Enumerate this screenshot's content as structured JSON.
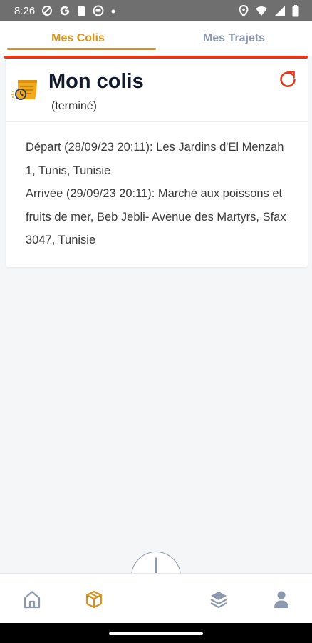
{
  "status_bar": {
    "time": "8:26",
    "left_icons": [
      "shield-icon",
      "google-icon",
      "sim-icon",
      "robot-icon",
      "dot-icon"
    ],
    "right_icons": [
      "location-icon",
      "wifi-icon",
      "signal-icon",
      "battery-icon"
    ]
  },
  "tabs": [
    {
      "label": "Mes Colis",
      "active": true
    },
    {
      "label": "Mes Trajets",
      "active": false
    }
  ],
  "colors": {
    "accent": "#d6921a",
    "inactive": "#8c98b0",
    "alert": "#e8351a",
    "title": "#141a2e"
  },
  "card": {
    "icon": "parcel-clock-icon",
    "title": "Mon colis",
    "status": "(terminé)",
    "refresh_icon": "refresh-icon",
    "departure": "Départ (28/09/23 20:11):  Les Jardins d'El Menzah 1, Tunis, Tunisie",
    "arrival": "Arrivée (29/09/23 20:11):  Marché aux poissons et fruits de mer, Beb Jebli- Avenue des Martyrs, Sfax 3047, Tunisie"
  },
  "bottom_nav": {
    "items": [
      "home-icon",
      "package-icon",
      "layers-icon",
      "profile-icon"
    ],
    "active": "package-icon",
    "fab_icon": "plus-icon"
  }
}
